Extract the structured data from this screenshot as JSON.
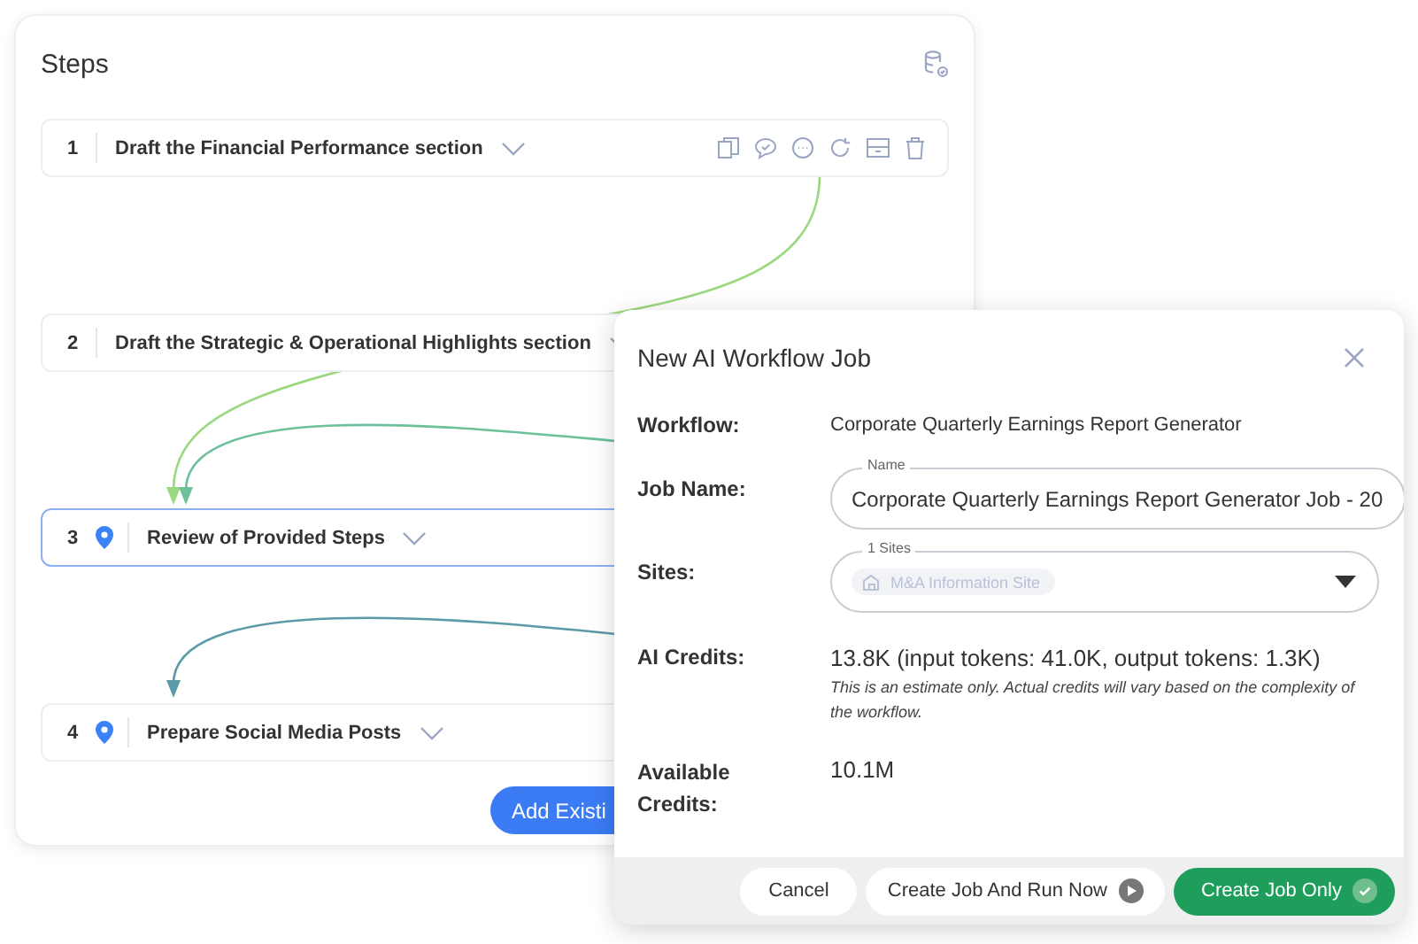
{
  "steps_panel": {
    "title": "Steps",
    "steps": [
      {
        "number": "1",
        "title": "Draft the Financial Performance section",
        "selected": false,
        "pinned": false,
        "actions": [
          {
            "kind": "copy"
          },
          {
            "kind": "comment"
          },
          {
            "kind": "more"
          },
          {
            "kind": "refresh"
          },
          {
            "kind": "archive"
          },
          {
            "kind": "delete"
          }
        ]
      },
      {
        "number": "2",
        "title": "Draft the Strategic & Operational Highlights section",
        "selected": false,
        "pinned": false
      },
      {
        "number": "3",
        "title": "Review of Provided Steps",
        "selected": true,
        "pinned": true
      },
      {
        "number": "4",
        "title": "Prepare Social Media Posts",
        "selected": false,
        "pinned": true
      }
    ],
    "add_button": "Add Existi"
  },
  "dialog": {
    "title": "New AI Workflow Job",
    "workflow": {
      "label": "Workflow:",
      "value": "Corporate Quarterly Earnings Report Generator"
    },
    "job_name": {
      "label": "Job Name:",
      "field_label": "Name",
      "value": "Corporate Quarterly Earnings Report Generator Job - 20"
    },
    "sites": {
      "label": "Sites:",
      "field_label": "1 Sites",
      "chip": "M&A Information Site"
    },
    "ai_credits": {
      "label": "AI Credits:",
      "value": "13.8K (input tokens: 41.0K, output tokens: 1.3K)",
      "note": "This is an estimate only. Actual credits will vary based on the complexity of the workflow."
    },
    "available_credits": {
      "label": "Available Credits:",
      "value": "10.1M"
    },
    "buttons": [
      {
        "label": "Cancel",
        "kind": "plain"
      },
      {
        "label": "Create Job And Run Now",
        "kind": "run"
      },
      {
        "label": "Create Job Only",
        "kind": "primary"
      }
    ]
  }
}
